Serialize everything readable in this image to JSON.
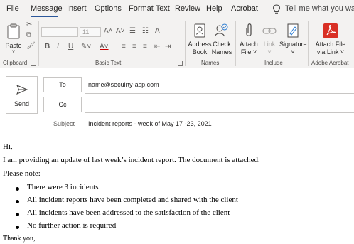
{
  "menu": {
    "tabs": [
      "File",
      "Message",
      "Insert",
      "Options",
      "Format Text",
      "Review",
      "Help",
      "Acrobat"
    ],
    "active_tab": "Message",
    "tell_me": "Tell me what you want"
  },
  "ribbon": {
    "clipboard": {
      "paste": "Paste",
      "group": "Clipboard"
    },
    "basic_text": {
      "font_size": "11",
      "group": "Basic Text"
    },
    "names": {
      "address_book": [
        "Address",
        "Book"
      ],
      "check_names": [
        "Check",
        "Names"
      ],
      "group": "Names"
    },
    "include": {
      "attach_file": [
        "Attach",
        "File ˅"
      ],
      "link": [
        "Link",
        "˅"
      ],
      "signature": [
        "Signature",
        "˅"
      ],
      "group": "Include"
    },
    "adobe": {
      "attach_via_link": [
        "Attach File",
        "via Link ˅"
      ],
      "group": "Adobe Acrobat"
    }
  },
  "compose": {
    "send": "Send",
    "to_label": "To",
    "to_value": "name@secuirty-asp.com",
    "cc_label": "Cc",
    "cc_value": "",
    "subject_label": "Subject",
    "subject_value": "Incident reports - week of May 17 -23, 2021"
  },
  "body": {
    "greeting": "Hi,",
    "intro": "I am providing an update of last week’s incident report. The document is attached.",
    "note": "Please note:",
    "bullets": [
      "There were 3 incidents",
      "All incident reports have been completed and shared with the client",
      "All incidents have been addressed to the satisfaction of the client",
      "No further action is required"
    ],
    "closing": "Thank you,"
  },
  "colors": {
    "accent": "#2b579a",
    "acrobat": "#d93025",
    "ribbon_bg": "#f3f2f1"
  }
}
